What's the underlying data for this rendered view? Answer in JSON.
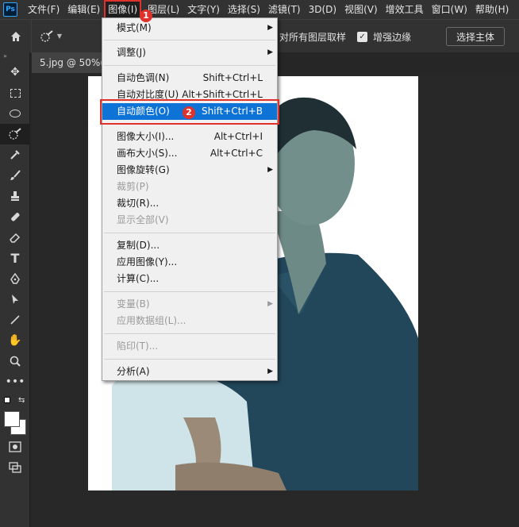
{
  "menubar": {
    "logo": "Ps",
    "items": [
      "文件(F)",
      "编辑(E)",
      "图像(I)",
      "图层(L)",
      "文字(Y)",
      "选择(S)",
      "滤镜(T)",
      "3D(D)",
      "视图(V)",
      "增效工具",
      "窗口(W)",
      "帮助(H)"
    ],
    "active_index": 2
  },
  "options": {
    "sample_all_layers": "对所有图层取样",
    "enhance_edge": "增强边缘",
    "select_subject": "选择主体"
  },
  "document": {
    "tab_title": "5.jpg @ 50%("
  },
  "dropdown": {
    "items": [
      {
        "label": "模式(M)",
        "shortcut": "",
        "submenu": true,
        "disabled": false
      },
      {
        "label": "调整(J)",
        "shortcut": "",
        "submenu": true,
        "disabled": false
      },
      {
        "label": "自动色调(N)",
        "shortcut": "Shift+Ctrl+L",
        "submenu": false,
        "disabled": false
      },
      {
        "label": "自动对比度(U)",
        "shortcut": "Alt+Shift+Ctrl+L",
        "submenu": false,
        "disabled": false
      },
      {
        "label": "自动颜色(O)",
        "shortcut": "Shift+Ctrl+B",
        "submenu": false,
        "disabled": false
      },
      {
        "label": "图像大小(I)...",
        "shortcut": "Alt+Ctrl+I",
        "submenu": false,
        "disabled": false
      },
      {
        "label": "画布大小(S)...",
        "shortcut": "Alt+Ctrl+C",
        "submenu": false,
        "disabled": false
      },
      {
        "label": "图像旋转(G)",
        "shortcut": "",
        "submenu": true,
        "disabled": false
      },
      {
        "label": "裁剪(P)",
        "shortcut": "",
        "submenu": false,
        "disabled": true
      },
      {
        "label": "裁切(R)...",
        "shortcut": "",
        "submenu": false,
        "disabled": false
      },
      {
        "label": "显示全部(V)",
        "shortcut": "",
        "submenu": false,
        "disabled": true
      },
      {
        "label": "复制(D)...",
        "shortcut": "",
        "submenu": false,
        "disabled": false
      },
      {
        "label": "应用图像(Y)...",
        "shortcut": "",
        "submenu": false,
        "disabled": false
      },
      {
        "label": "计算(C)...",
        "shortcut": "",
        "submenu": false,
        "disabled": false
      },
      {
        "label": "变量(B)",
        "shortcut": "",
        "submenu": true,
        "disabled": true
      },
      {
        "label": "应用数据组(L)...",
        "shortcut": "",
        "submenu": false,
        "disabled": true
      },
      {
        "label": "陷印(T)...",
        "shortcut": "",
        "submenu": false,
        "disabled": true
      },
      {
        "label": "分析(A)",
        "shortcut": "",
        "submenu": true,
        "disabled": false
      }
    ],
    "highlighted_index": 4
  },
  "annotations": {
    "step1": "1",
    "step2": "2",
    "color": "#e0312c"
  },
  "icons": {
    "home": "home-icon",
    "brush": "quick-selection-brush-icon",
    "tools": [
      "move-icon",
      "marquee-icon",
      "lasso-icon",
      "quick-selection-icon",
      "eyedropper-icon",
      "brush-icon",
      "clone-stamp-icon",
      "eraser-icon",
      "pen-icon",
      "type-icon",
      "path-selection-icon",
      "pointer-icon",
      "line-icon",
      "hand-icon",
      "zoom-icon",
      "more-icon"
    ]
  }
}
